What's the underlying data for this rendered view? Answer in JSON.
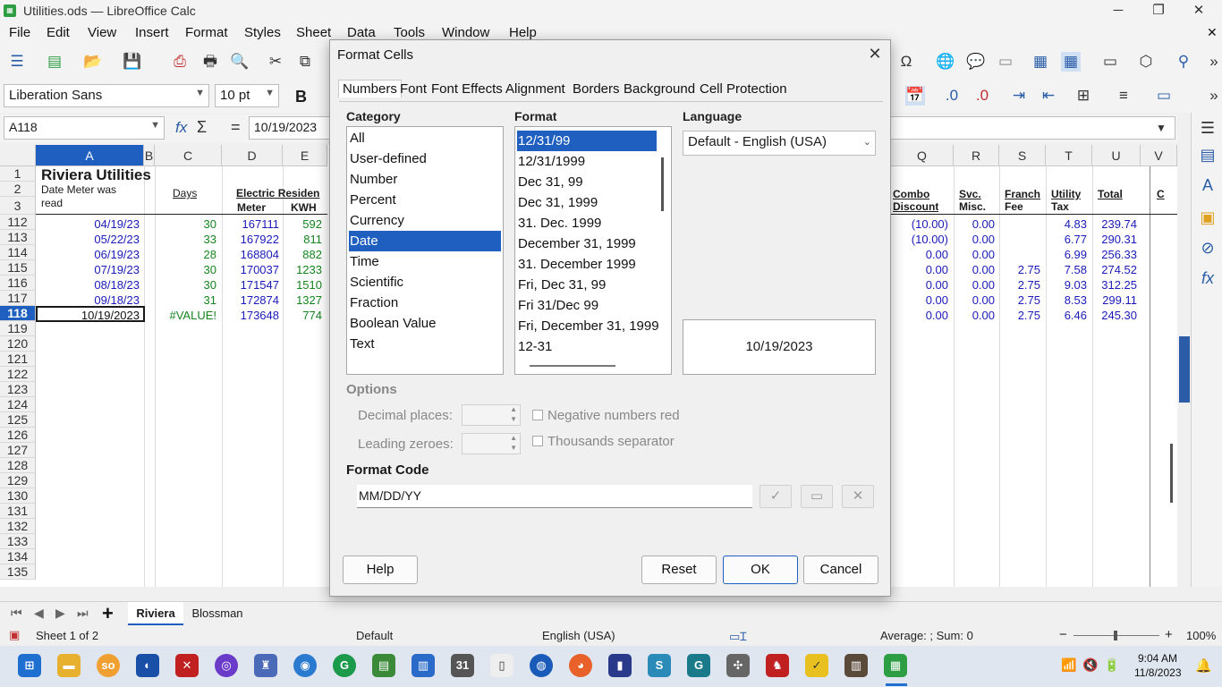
{
  "window": {
    "title": "Utilities.ods — LibreOffice Calc",
    "app_icon": "calc-icon"
  },
  "menu": [
    "File",
    "Edit",
    "View",
    "Insert",
    "Format",
    "Styles",
    "Sheet",
    "Data",
    "Tools",
    "Window",
    "Help"
  ],
  "font_bar": {
    "font_name": "Liberation Sans",
    "font_size": "10 pt",
    "bold_label": "B"
  },
  "formula_bar": {
    "cell_ref": "A118",
    "fx": "fx",
    "sigma": "Σ",
    "equals": "=",
    "formula": "10/19/2023"
  },
  "sheet": {
    "columns_left": [
      "A",
      "B",
      "C",
      "D",
      "E"
    ],
    "columns_right": [
      "Q",
      "R",
      "S",
      "T",
      "U",
      "V"
    ],
    "row_numbers": [
      "1",
      "2",
      "3",
      "112",
      "113",
      "114",
      "115",
      "116",
      "117",
      "118",
      "119",
      "120",
      "121",
      "122",
      "123",
      "124",
      "125",
      "126",
      "127",
      "128",
      "129",
      "130",
      "131",
      "132",
      "133",
      "134",
      "135"
    ],
    "title_cell": "Riviera Utilities",
    "header_a_line1": "Date Meter was",
    "header_a_line2": "read",
    "header_c": "Days",
    "header_d": "Electric Residen",
    "header_d3": "Meter",
    "header_e3": "KWH",
    "right_headers": [
      {
        "l1": "Combo",
        "l2": "Discount"
      },
      {
        "l1": "Svc.",
        "l2": "Misc."
      },
      {
        "l1": "Franch",
        "l2": "Fee"
      },
      {
        "l1": "Utility",
        "l2": "Tax"
      },
      {
        "l1": "Total",
        "l2": ""
      },
      {
        "l1": "C",
        "l2": ""
      }
    ],
    "rows": [
      {
        "a": "04/19/23",
        "c": "30",
        "d": "167111",
        "e": "592",
        "q": "(10.00)",
        "r": "0.00",
        "s": "",
        "t": "4.83",
        "u": "239.74"
      },
      {
        "a": "05/22/23",
        "c": "33",
        "d": "167922",
        "e": "811",
        "q": "(10.00)",
        "r": "0.00",
        "s": "",
        "t": "6.77",
        "u": "290.31"
      },
      {
        "a": "06/19/23",
        "c": "28",
        "d": "168804",
        "e": "882",
        "q": "0.00",
        "r": "0.00",
        "s": "",
        "t": "6.99",
        "u": "256.33"
      },
      {
        "a": "07/19/23",
        "c": "30",
        "d": "170037",
        "e": "1233",
        "q": "0.00",
        "r": "0.00",
        "s": "2.75",
        "t": "7.58",
        "u": "274.52"
      },
      {
        "a": "08/18/23",
        "c": "30",
        "d": "171547",
        "e": "1510",
        "q": "0.00",
        "r": "0.00",
        "s": "2.75",
        "t": "9.03",
        "u": "312.25"
      },
      {
        "a": "09/18/23",
        "c": "31",
        "d": "172874",
        "e": "1327",
        "q": "0.00",
        "r": "0.00",
        "s": "2.75",
        "t": "8.53",
        "u": "299.11"
      },
      {
        "a": "10/19/2023",
        "c": "#VALUE!",
        "d": "173648",
        "e": "774",
        "q": "0.00",
        "r": "0.00",
        "s": "2.75",
        "t": "6.46",
        "u": "245.30"
      }
    ]
  },
  "tabs": {
    "add": "+",
    "items": [
      "Riviera",
      "Blossman"
    ],
    "active": "Riviera"
  },
  "status": {
    "sheet_info": "Sheet 1 of 2",
    "page_style": "Default",
    "language": "English (USA)",
    "summary": "Average: ; Sum: 0",
    "zoom": "100%"
  },
  "taskbar": {
    "time": "9:04 AM",
    "date": "11/8/2023"
  },
  "dialog": {
    "title": "Format Cells",
    "close": "✕",
    "tabs": [
      "Numbers",
      "Font",
      "Font Effects",
      "Alignment",
      "Borders",
      "Background",
      "Cell Protection"
    ],
    "active_tab": "Numbers",
    "category_label": "Category",
    "categories": [
      "All",
      "User-defined",
      "Number",
      "Percent",
      "Currency",
      "Date",
      "Time",
      "Scientific",
      "Fraction",
      "Boolean Value",
      "Text"
    ],
    "selected_category": "Date",
    "format_label": "Format",
    "formats": [
      "12/31/99",
      "12/31/1999",
      "Dec 31, 99",
      "Dec 31, 1999",
      "31. Dec. 1999",
      "December 31, 1999",
      "31. December 1999",
      "Fri, Dec 31, 99",
      "Fri 31/Dec 99",
      "Fri, December 31, 1999",
      "12-31"
    ],
    "selected_format": "12/31/99",
    "language_label": "Language",
    "language_value": "Default - English (USA)",
    "preview": "10/19/2023",
    "options_label": "Options",
    "decimal_places_label": "Decimal places:",
    "leading_zeroes_label": "Leading zeroes:",
    "negative_red_label": "Negative numbers red",
    "thousands_label": "Thousands separator",
    "format_code_label": "Format Code",
    "format_code": "MM/DD/YY",
    "buttons": {
      "help": "Help",
      "reset": "Reset",
      "ok": "OK",
      "cancel": "Cancel"
    }
  }
}
